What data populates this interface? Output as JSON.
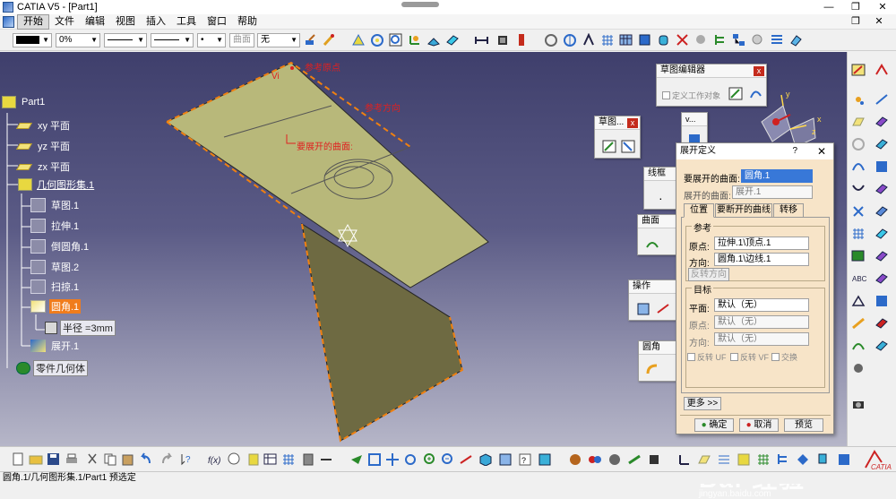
{
  "window": {
    "title": "CATIA V5 - [Part1]",
    "min": "—",
    "restore": "❐",
    "close": "✕"
  },
  "menu": {
    "items": [
      "开始",
      "文件",
      "编辑",
      "视图",
      "插入",
      "工具",
      "窗口",
      "帮助"
    ],
    "mdi_restore": "❐",
    "mdi_close": "✕"
  },
  "toolbar": {
    "transparency": "0%",
    "layer_combo": "曲面",
    "layer_value": "无"
  },
  "tree": {
    "root": "Part1",
    "xy": "xy 平面",
    "yz": "yz 平面",
    "zx": "zx 平面",
    "geo_set": "几何图形集.1",
    "sketch1": "草图.1",
    "extrude1": "拉伸.1",
    "chamfer1": "倒圆角.1",
    "sketch2": "草图.2",
    "sweep1": "扫掠.1",
    "fillet1": "圆角.1",
    "radius": "半径 =3mm",
    "unfold1": "展开.1",
    "body": "零件几何体"
  },
  "annotations": {
    "ref_origin": "参考原点",
    "ref_dir": "参考方向",
    "surface_to_unfold": "要展开的曲面:",
    "vi": "Vi"
  },
  "floating_toolbars": {
    "sketch_editor": "草图编辑器",
    "define_work_obj": "定义工作对象",
    "sketch": "草图...",
    "v": "v...",
    "wireframe": "线框",
    "surface": "曲面",
    "operation": "操作",
    "fillet": "圆角"
  },
  "dialog": {
    "title": "展开定义",
    "help": "?",
    "close": "✕",
    "surface_to_unfold_label": "要展开的曲面:",
    "surface_to_unfold_value": "圆角.1",
    "unfolded_surface_label": "展开的曲面:",
    "unfolded_surface_value": "展开.1",
    "tabs": [
      "位置",
      "要断开的曲线",
      "转移"
    ],
    "ref_group": "参考",
    "origin_label": "原点:",
    "origin_value": "拉伸.1\\顶点.1",
    "direction_label": "方向:",
    "direction_value": "圆角.1\\边线.1",
    "reverse_dir": "反转方向",
    "target_group": "目标",
    "plane_label": "平面:",
    "plane_value": "默认（无）",
    "t_origin_label": "原点:",
    "t_origin_value": "默认（无）",
    "t_dir_label": "方向:",
    "t_dir_value": "默认（无）",
    "rev_uf": "反转 UF",
    "rev_vf": "反转 VF",
    "swap": "交换",
    "more": "更多 >>",
    "ok": "确定",
    "cancel": "取消",
    "preview": "预览"
  },
  "compass": {
    "x": "x",
    "y": "y",
    "z": "z"
  },
  "watermark": {
    "main": "Bai 经验",
    "sub": "jingyan.baidu.com"
  },
  "status": "圆角.1/几何图形集.1/Part1 预选定",
  "colors": {
    "surface": "#b8b87a",
    "surface_dark": "#6e6a42",
    "selection": "#f07c1c",
    "dialog_bg": "#f7e4c8",
    "viewport_top": "#3f3f6c"
  }
}
